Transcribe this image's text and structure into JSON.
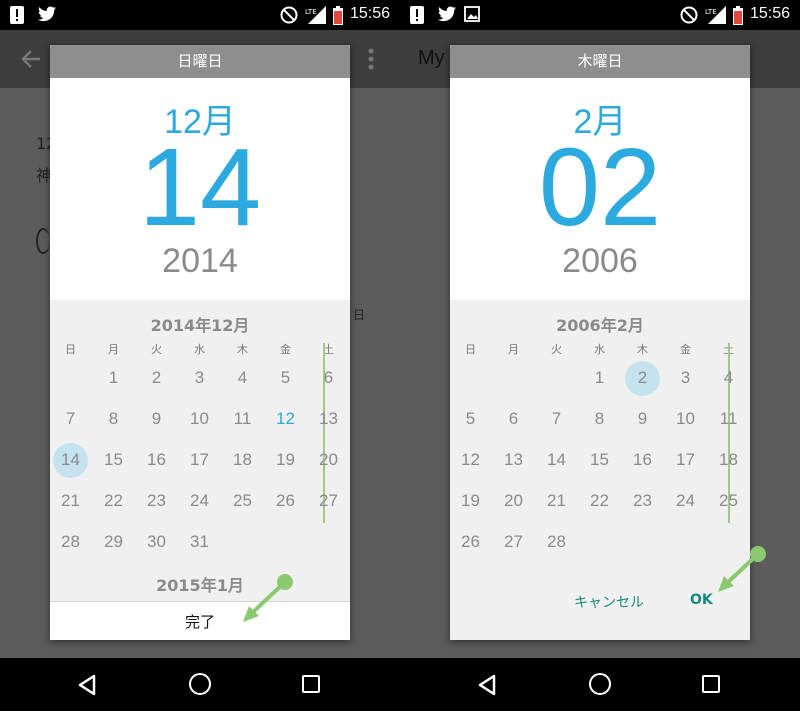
{
  "status_bar": {
    "time": "15:56",
    "lte": "LTE"
  },
  "left": {
    "app_title_peek": "",
    "content_text": [
      "12",
      "神"
    ],
    "side_label": "日",
    "dialog": {
      "weekday": "日曜日",
      "month": "12月",
      "day": "14",
      "year": "2014",
      "calendar_month": "2014年12月",
      "next_month": "2015年1月",
      "done_label": "完了",
      "days_of_week": [
        "日",
        "月",
        "火",
        "水",
        "木",
        "金",
        "土"
      ],
      "days": [
        [
          "",
          "1",
          "2",
          "3",
          "4",
          "5",
          "6"
        ],
        [
          "7",
          "8",
          "9",
          "10",
          "11",
          "12",
          "13"
        ],
        [
          "14",
          "15",
          "16",
          "17",
          "18",
          "19",
          "20"
        ],
        [
          "21",
          "22",
          "23",
          "24",
          "25",
          "26",
          "27"
        ],
        [
          "28",
          "29",
          "30",
          "31",
          "",
          "",
          ""
        ]
      ],
      "selected_day": "14",
      "today": "12"
    }
  },
  "right": {
    "app_title": "My",
    "dialog": {
      "weekday": "木曜日",
      "month": "2月",
      "day": "02",
      "year": "2006",
      "calendar_month": "2006年2月",
      "cancel_label": "キャンセル",
      "ok_label": "OK",
      "days_of_week": [
        "日",
        "月",
        "火",
        "水",
        "木",
        "金",
        "土"
      ],
      "days": [
        [
          "",
          "",
          "",
          "1",
          "2",
          "3",
          "4"
        ],
        [
          "5",
          "6",
          "7",
          "8",
          "9",
          "10",
          "11"
        ],
        [
          "12",
          "13",
          "14",
          "15",
          "16",
          "17",
          "18"
        ],
        [
          "19",
          "20",
          "21",
          "22",
          "23",
          "24",
          "25"
        ],
        [
          "26",
          "27",
          "28",
          "",
          "",
          "",
          ""
        ]
      ],
      "selected_day": "2"
    }
  },
  "colors": {
    "accent": "#2ca9de",
    "selection": "#c5e3ef",
    "button_text": "#16897e",
    "annotation": "#8bc971"
  },
  "icons": [
    "alert-icon",
    "twitter-icon",
    "image-icon",
    "do-not-disturb-icon",
    "lte-signal-icon",
    "battery-icon",
    "back-arrow-icon",
    "overflow-menu-icon",
    "nav-back-icon",
    "nav-home-icon",
    "nav-recents-icon"
  ]
}
